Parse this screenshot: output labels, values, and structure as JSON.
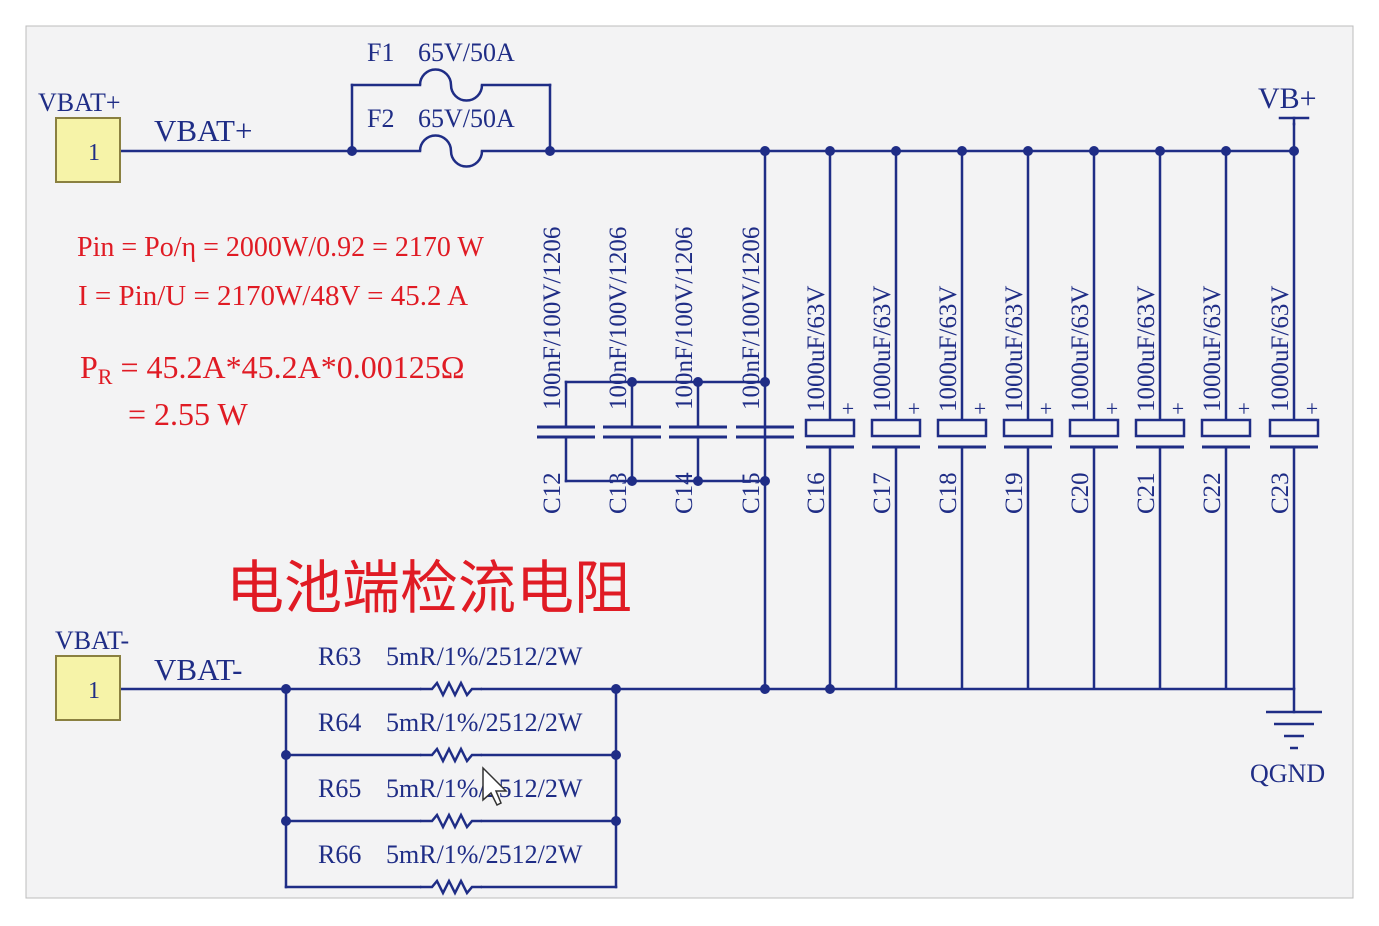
{
  "colors": {
    "background": "#f3f3f4",
    "wire": "#1f2d86",
    "label": "#1f2d86",
    "note": "#e01b24",
    "connector_fill": "#f6f3a8",
    "connector_stroke": "#8a8040"
  },
  "connectors": [
    {
      "net": "VBAT+",
      "net_label": "VBAT+",
      "pin": "1"
    },
    {
      "net": "VBAT-",
      "net_label": "VBAT-",
      "pin": "1"
    }
  ],
  "fuses": [
    {
      "ref": "F1",
      "value": "65V/50A"
    },
    {
      "ref": "F2",
      "value": "65V/50A"
    }
  ],
  "power_port": {
    "label": "VB+"
  },
  "ground_port": {
    "label": "QGND"
  },
  "ceramic_caps": [
    {
      "ref": "C12",
      "value": "100nF/100V/1206"
    },
    {
      "ref": "C13",
      "value": "100nF/100V/1206"
    },
    {
      "ref": "C14",
      "value": "100nF/100V/1206"
    },
    {
      "ref": "C15",
      "value": "100nF/100V/1206"
    }
  ],
  "electrolytic_caps": [
    {
      "ref": "C16",
      "value": "1000uF/63V"
    },
    {
      "ref": "C17",
      "value": "1000uF/63V"
    },
    {
      "ref": "C18",
      "value": "1000uF/63V"
    },
    {
      "ref": "C19",
      "value": "1000uF/63V"
    },
    {
      "ref": "C20",
      "value": "1000uF/63V"
    },
    {
      "ref": "C21",
      "value": "1000uF/63V"
    },
    {
      "ref": "C22",
      "value": "1000uF/63V"
    },
    {
      "ref": "C23",
      "value": "1000uF/63V"
    }
  ],
  "polarity_mark": "+",
  "resistors": [
    {
      "ref": "R63",
      "value": "5mR/1%/2512/2W"
    },
    {
      "ref": "R64",
      "value": "5mR/1%/2512/2W"
    },
    {
      "ref": "R65",
      "value": "5mR/1%/2512/2W"
    },
    {
      "ref": "R66",
      "value": "5mR/1%/2512/2W"
    }
  ],
  "annotations": {
    "line1": "Pin = Po/η = 2000W/0.92 = 2170 W",
    "line2": "I = Pin/U = 2170W/48V = 45.2 A",
    "line3_prefix": "P",
    "line3_sub": "R",
    "line3_rest": " = 45.2A*45.2A*0.00125Ω",
    "line4": "= 2.55 W",
    "title": "电池端检流电阻"
  }
}
